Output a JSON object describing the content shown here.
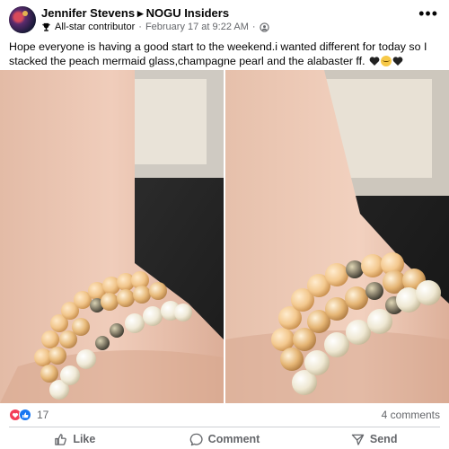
{
  "post": {
    "author": "Jennifer Stevens",
    "group": "NOGU Insiders",
    "badge": "All-star contributor",
    "date": "February 17 at 9:22 AM",
    "separator": "·",
    "caption": "Hope everyone is having a good start to the weekend.i wanted different for today so I stacked the peach mermaid glass,champagne pearl and the alabaster ff."
  },
  "engagement": {
    "reaction_count": "17",
    "comments": "4 comments"
  },
  "actions": {
    "like": "Like",
    "comment": "Comment",
    "send": "Send"
  },
  "colors": {
    "secondary_text": "#65676b",
    "like_blue": "#1877f2",
    "love_red": "#f33e58"
  }
}
